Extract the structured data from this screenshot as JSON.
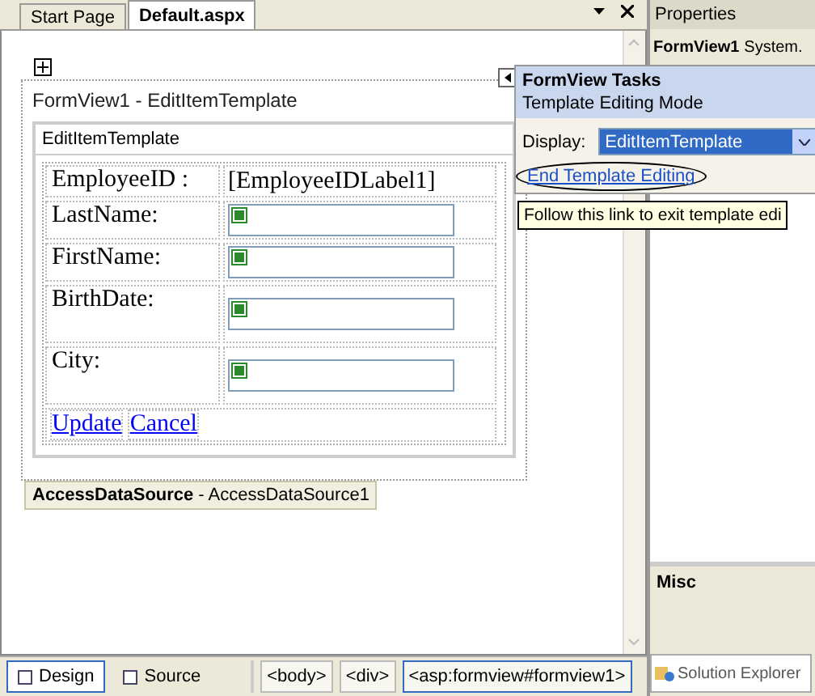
{
  "tabs": [
    {
      "label": "Start Page",
      "selected": false
    },
    {
      "label": "Default.aspx",
      "selected": true
    }
  ],
  "formview": {
    "title": "FormView1 - EditItemTemplate",
    "template_header": "EditItemTemplate",
    "rows": [
      {
        "kind": "label",
        "label": "EmployeeID :",
        "value": "[EmployeeIDLabel1]"
      },
      {
        "kind": "textbox",
        "label": "LastName:"
      },
      {
        "kind": "textbox",
        "label": "FirstName:"
      },
      {
        "kind": "tallbox",
        "label": "BirthDate:"
      },
      {
        "kind": "tallbox",
        "label": "City:"
      }
    ],
    "links": [
      "Update",
      "Cancel"
    ]
  },
  "datasource": {
    "type": "AccessDataSource",
    "name": "- AccessDataSource1"
  },
  "tasks": {
    "title": "FormView Tasks",
    "subtitle": "Template Editing Mode",
    "display_label": "Display:",
    "display_value": "EditItemTemplate",
    "link": "End Template Editing",
    "tooltip": "Follow this link to exit template edi"
  },
  "properties": {
    "title": "Properties",
    "object": "FormView1",
    "type": "System.",
    "category": "Misc"
  },
  "view_tabs": [
    {
      "label": "Design",
      "selected": true
    },
    {
      "label": "Source",
      "selected": false
    }
  ],
  "tag_path": [
    {
      "label": "<body>",
      "selected": false
    },
    {
      "label": "<div>",
      "selected": false
    },
    {
      "label": "<asp:formview#formview1>",
      "selected": true
    }
  ],
  "solution_explorer": "Solution Explorer"
}
